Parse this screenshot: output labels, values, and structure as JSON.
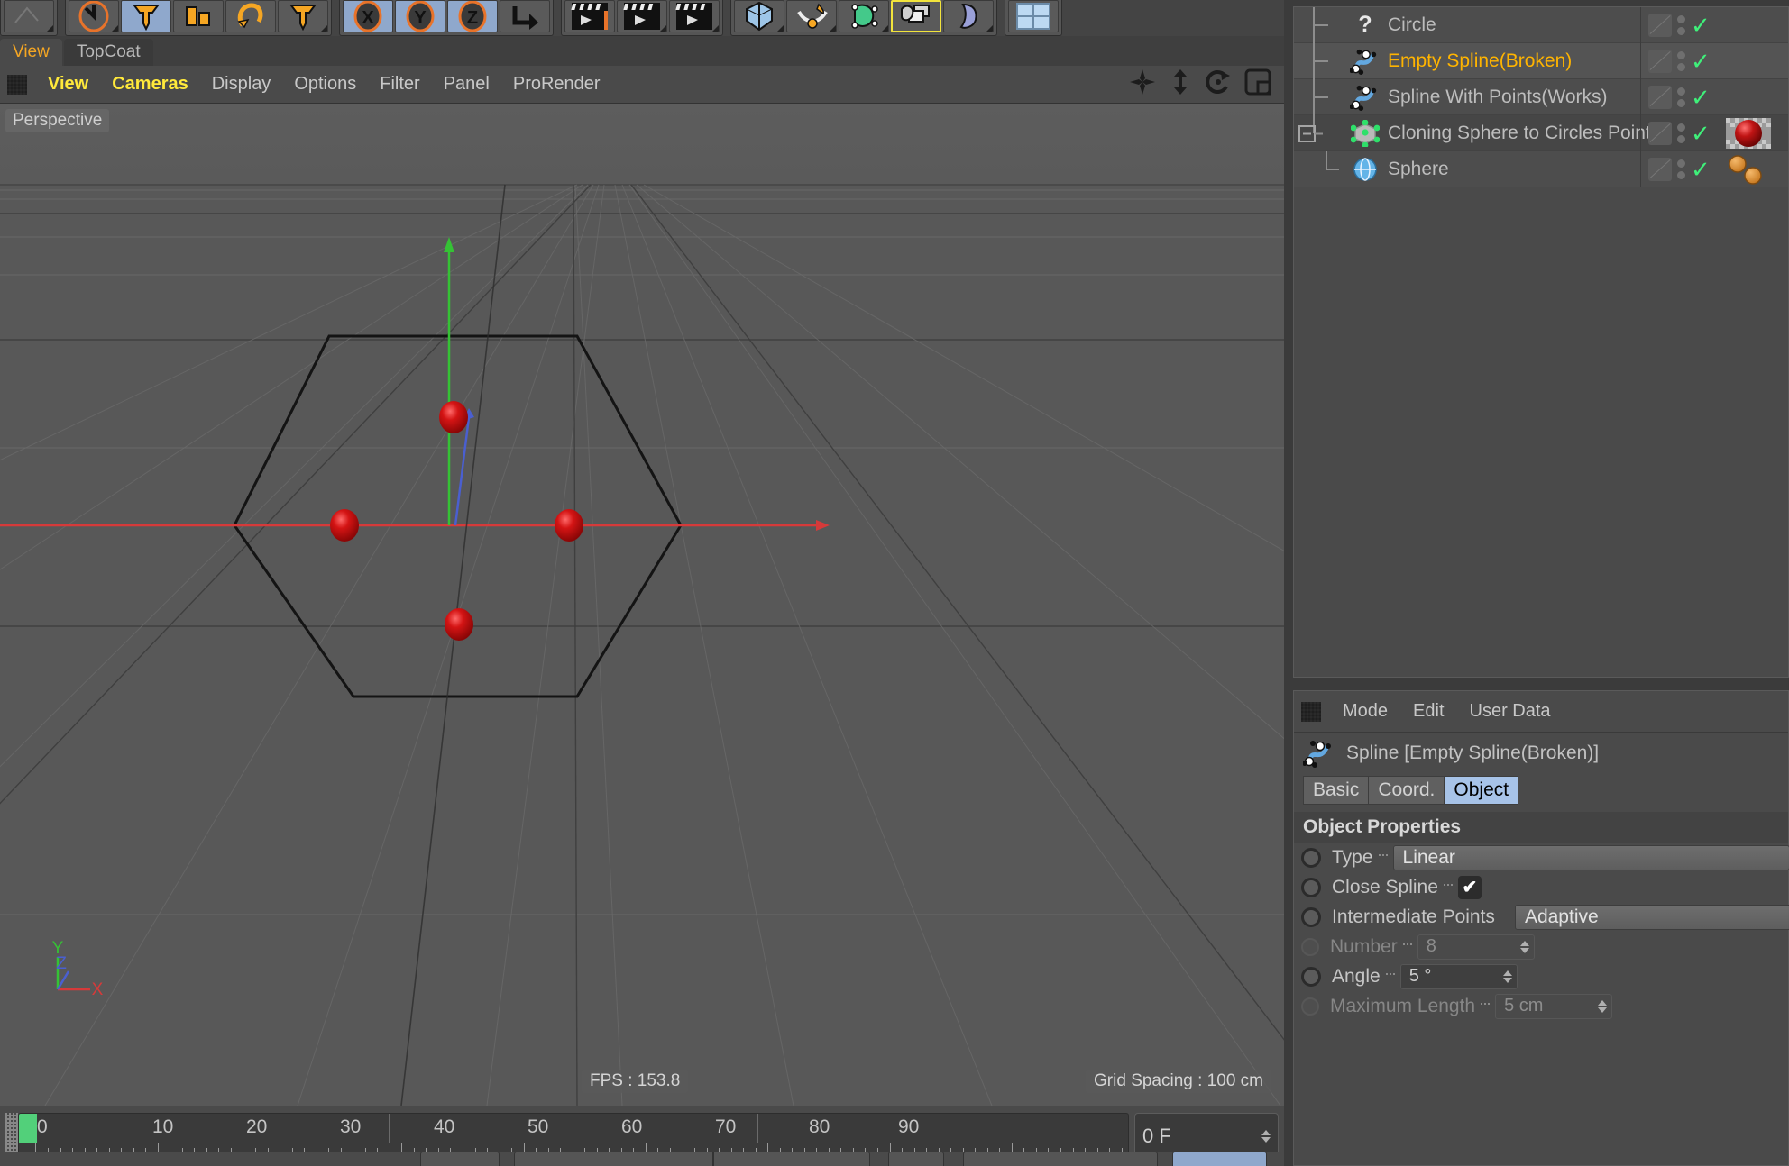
{
  "app": "Cinema 4D",
  "viewport_tabs": [
    {
      "label": "View",
      "active": true
    },
    {
      "label": "TopCoat",
      "active": false
    }
  ],
  "viewport_menu": [
    {
      "label": "View",
      "highlight": true
    },
    {
      "label": "Cameras",
      "highlight": true
    },
    {
      "label": "Display",
      "highlight": false
    },
    {
      "label": "Options",
      "highlight": false
    },
    {
      "label": "Filter",
      "highlight": false
    },
    {
      "label": "Panel",
      "highlight": false
    },
    {
      "label": "ProRender",
      "highlight": false
    }
  ],
  "viewport": {
    "label": "Perspective",
    "fps": "FPS : 153.8",
    "grid_spacing": "Grid Spacing : 100 cm",
    "axis_labels": {
      "x": "X",
      "y": "Y",
      "z": "Z"
    },
    "axis_colors": {
      "x": "#d63a3a",
      "y": "#35c235",
      "z": "#4a5fd0"
    },
    "scene_objects": {
      "hexagon_spline": "Circle (hexagon outline)",
      "sphere_count": 4,
      "sphere_color": "#cc1111"
    }
  },
  "object_manager": {
    "rows": [
      {
        "name": "Circle",
        "icon": "question-mark-icon",
        "indent": 1,
        "selected": false,
        "highlight": false,
        "expander": false,
        "visible_check": true,
        "tag_swatch": null
      },
      {
        "name": "Empty Spline(Broken)",
        "icon": "spline-icon",
        "indent": 1,
        "selected": true,
        "highlight": true,
        "expander": false,
        "visible_check": true,
        "tag_swatch": null
      },
      {
        "name": "Spline With Points(Works)",
        "icon": "spline-icon",
        "indent": 1,
        "selected": false,
        "highlight": false,
        "expander": false,
        "visible_check": true,
        "tag_swatch": null
      },
      {
        "name": "Cloning Sphere to Circles Points",
        "icon": "cloner-icon",
        "indent": 0,
        "selected": false,
        "highlight": false,
        "expander": true,
        "visible_check": true,
        "tag_swatch": "red-sphere-material"
      },
      {
        "name": "Sphere",
        "icon": "sphere-icon",
        "indent": 2,
        "selected": false,
        "highlight": false,
        "expander": false,
        "visible_check": true,
        "tag_swatch": "orange-dots-tag"
      }
    ]
  },
  "attributes": {
    "menu": [
      "Mode",
      "Edit",
      "User Data"
    ],
    "title": "Spline [Empty Spline(Broken)]",
    "title_icon": "spline-icon",
    "tabs": [
      {
        "label": "Basic",
        "active": false
      },
      {
        "label": "Coord.",
        "active": false
      },
      {
        "label": "Object",
        "active": true
      }
    ],
    "section_title": "Object Properties",
    "properties": [
      {
        "label": "Type",
        "control": "combo",
        "value": "Linear",
        "enabled": true,
        "dots": 12
      },
      {
        "label": "Close Spline",
        "control": "checkbox",
        "value": "✔",
        "enabled": true,
        "dots": 7
      },
      {
        "label": "Intermediate Points",
        "control": "combo",
        "value": "Adaptive",
        "enabled": true,
        "dots": 0
      },
      {
        "label": "Number",
        "control": "number",
        "value": "8",
        "enabled": false,
        "dots": 9
      },
      {
        "label": "Angle",
        "control": "number",
        "value": "5 °",
        "enabled": true,
        "dots": 11
      },
      {
        "label": "Maximum Length",
        "control": "number",
        "value": "5 cm",
        "enabled": false,
        "dots": 2
      }
    ]
  },
  "timeline": {
    "tick_labels": [
      "0",
      "10",
      "20",
      "30",
      "40",
      "50",
      "60",
      "70",
      "80",
      "90"
    ],
    "current_frame": "0 F",
    "playhead_frame": 0
  },
  "colors": {
    "accent_orange": "#f5a623",
    "highlight_yellow": "#ffe93b",
    "selection_blue": "#a7c3e8",
    "check_green": "#3ff07a",
    "object_highlight": "#ffb400"
  }
}
